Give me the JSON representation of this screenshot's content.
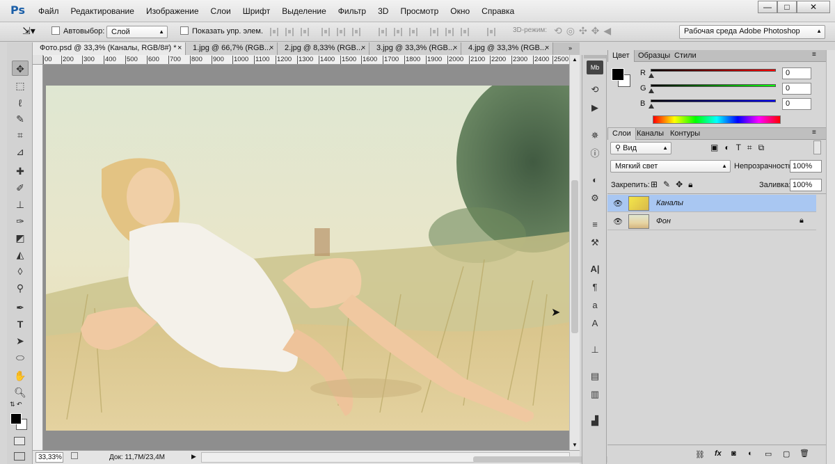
{
  "app": {
    "logo": "Ps"
  },
  "menu": [
    "Файл",
    "Редактирование",
    "Изображение",
    "Слои",
    "Шрифт",
    "Выделение",
    "Фильтр",
    "3D",
    "Просмотр",
    "Окно",
    "Справка"
  ],
  "window_controls": {
    "minimize": "—",
    "maximize": "□",
    "close": "✕"
  },
  "options": {
    "autoselect_label": "Автовыбор:",
    "autoselect_value": "Слой",
    "show_controls_label": "Показать упр. элем.",
    "mode_3d_label": "3D-режим:",
    "workspace": "Рабочая среда Adobe Photoshop"
  },
  "tabs": [
    {
      "label": "Фото.psd @ 33,3% (Каналы, RGB/8#) *",
      "active": true
    },
    {
      "label": "1.jpg @ 66,7% (RGB...",
      "active": false
    },
    {
      "label": "2.jpg @ 8,33% (RGB...",
      "active": false
    },
    {
      "label": "3.jpg @ 33,3% (RGB...",
      "active": false
    },
    {
      "label": "4.jpg @ 33,3% (RGB...",
      "active": false
    }
  ],
  "ruler_ticks": [
    "00",
    "200",
    "300",
    "400",
    "500",
    "600",
    "700",
    "800",
    "900",
    "1000",
    "1100",
    "1200",
    "1300",
    "1400",
    "1500",
    "1600",
    "1700",
    "1800",
    "1900",
    "2000",
    "2100",
    "2200",
    "2300",
    "2400",
    "2500"
  ],
  "status": {
    "zoom": "33,33%",
    "doc": "Док: 11,7M/23,4M"
  },
  "color_panel": {
    "tabs": [
      "Цвет",
      "Образцы",
      "Стили"
    ],
    "channels": [
      {
        "label": "R",
        "value": "0",
        "color": "#e00000"
      },
      {
        "label": "G",
        "value": "0",
        "color": "#00c000"
      },
      {
        "label": "B",
        "value": "0",
        "color": "#0000e0"
      }
    ],
    "foreground": "#000000",
    "background": "#ffffff"
  },
  "layers_panel": {
    "tabs": [
      "Слои",
      "Каналы",
      "Контуры"
    ],
    "filter": "Вид",
    "blend_mode": "Мягкий свет",
    "opacity_label": "Непрозрачность:",
    "opacity": "100%",
    "lock_label": "Закрепить:",
    "fill_label": "Заливка:",
    "fill": "100%",
    "layers": [
      {
        "name": "Каналы",
        "selected": true,
        "locked": false
      },
      {
        "name": "Фон",
        "selected": false,
        "locked": true
      }
    ]
  },
  "colors": {
    "selected_layer": "#a9c7f2",
    "accent": "#1b5fa8"
  }
}
